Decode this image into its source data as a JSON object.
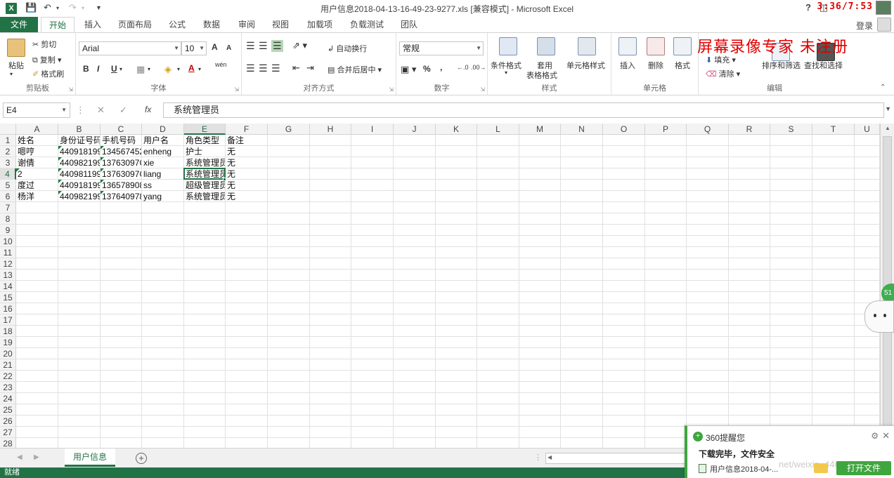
{
  "window": {
    "title": "用户信息2018-04-13-16-49-23-9277.xls  [兼容模式] - Microsoft Excel",
    "help": "?",
    "recording_time": "3:36/7:53"
  },
  "tabs": {
    "file": "文件",
    "items": [
      "开始",
      "插入",
      "页面布局",
      "公式",
      "数据",
      "审阅",
      "视图",
      "加载项",
      "负载测试",
      "团队"
    ],
    "active": "开始",
    "login": "登录"
  },
  "ribbon": {
    "clipboard": {
      "label": "剪贴板",
      "paste": "粘贴",
      "cut": "剪切",
      "copy": "复制",
      "format_painter": "格式刷"
    },
    "font": {
      "label": "字体",
      "name": "Arial",
      "size": "10",
      "bold": "B",
      "italic": "I",
      "underline": "U",
      "grow": "A",
      "shrink": "A",
      "font_color": "A",
      "phonetic": "wén"
    },
    "alignment": {
      "label": "对齐方式",
      "wrap": "自动换行",
      "merge": "合并后居中"
    },
    "number": {
      "label": "数字",
      "format": "常规",
      "percent": "%",
      "comma": ","
    },
    "styles": {
      "label": "样式",
      "conditional": "条件格式",
      "table_line1": "套用",
      "table_line2": "表格格式",
      "cell_styles": "单元格样式"
    },
    "cells": {
      "label": "单元格",
      "insert": "插入",
      "delete": "删除",
      "format": "格式"
    },
    "editing": {
      "label": "编辑",
      "fill": "填充",
      "clear": "清除",
      "sort_filter": "排序和筛选",
      "find_select": "查找和选择"
    }
  },
  "watermark": "屏幕录像专家  未注册",
  "formula_bar": {
    "name_box": "E4",
    "fx": "fx",
    "content": "系统管理员"
  },
  "sheet": {
    "columns": [
      "A",
      "B",
      "C",
      "D",
      "E",
      "F",
      "G",
      "H",
      "I",
      "J",
      "K",
      "L",
      "M",
      "N",
      "O",
      "P",
      "Q",
      "R",
      "S",
      "T",
      "U"
    ],
    "row_numbers": [
      "1",
      "2",
      "3",
      "4",
      "5",
      "6",
      "7",
      "8",
      "9",
      "10",
      "11",
      "12",
      "13",
      "14",
      "15",
      "16",
      "17",
      "18",
      "19",
      "20",
      "21",
      "22",
      "23",
      "24",
      "25",
      "26",
      "27",
      "28"
    ],
    "selected_column": "E",
    "selected_row": "4",
    "rows": [
      [
        "姓名",
        "身份证号码",
        "手机号码",
        "用户名",
        "角色类型",
        "备注"
      ],
      [
        "嗯哼",
        "440918199",
        "134567452",
        "enheng",
        "护士",
        "无"
      ],
      [
        "谢倩",
        "440982199",
        "13763097C",
        "xie",
        "系统管理员",
        "无"
      ],
      [
        "2",
        "440981199",
        "13763097C",
        "liang",
        "系统管理员",
        "无"
      ],
      [
        "度过",
        "440918199",
        "136578908",
        "ss",
        "超级管理员",
        "无"
      ],
      [
        "杨洋",
        "440982199",
        "137640978",
        "yang",
        "系统管理员",
        "无"
      ]
    ]
  },
  "sheet_tabs": {
    "active": "用户信息",
    "add": "+"
  },
  "status": "就绪",
  "popup": {
    "title": "360提醒您",
    "message": "下载完毕，文件安全",
    "file": "用户信息2018-04-...",
    "open_button": "打开文件",
    "url_overlay": "net/weixin_44640455"
  },
  "float_ball": "51"
}
